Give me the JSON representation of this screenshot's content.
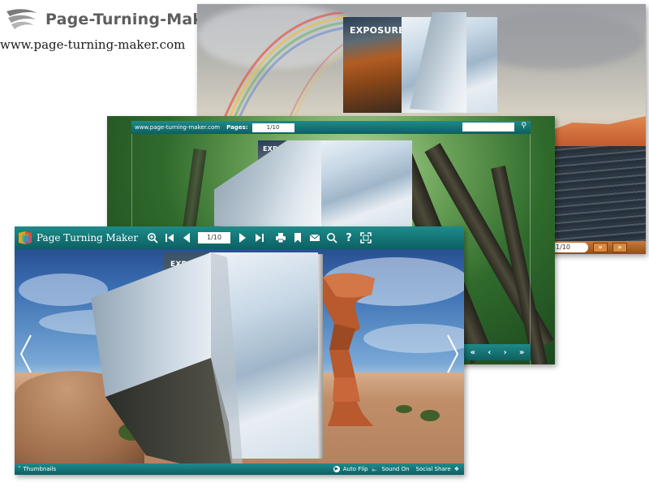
{
  "brand": {
    "name": "Page-Turning-Maker",
    "url": "www.page-turning-maker.com"
  },
  "back_window": {
    "cover_title": "EXPOSURE",
    "page_value": "1/10",
    "next_label": "»",
    "last_label": "»"
  },
  "middle_window": {
    "site_label": "www.page-turning-maker.com",
    "pages_label": "Pages:",
    "page_value": "1/10",
    "search_placeholder": "",
    "cover_title": "EXPO",
    "nav": {
      "first": "«",
      "prev": "‹",
      "next": "›",
      "last": "»"
    }
  },
  "front_window": {
    "app_title": "Page Turning Maker",
    "page_value": "1/10",
    "toolbar_icons": [
      "zoom-in-icon",
      "first-page-icon",
      "prev-page-icon",
      "next-page-icon",
      "last-page-icon",
      "print-icon",
      "bookmark-icon",
      "email-icon",
      "search-icon",
      "help-icon",
      "fullscreen-icon"
    ],
    "help_glyph": "?",
    "thumbnails_label": "Thumbnails",
    "auto_flip_label": "Auto Flip",
    "sound_label": "Sound On",
    "social_share_label": "Social Share",
    "cover_title": "EXPOSURE"
  },
  "colors": {
    "toolbar_teal": "#0c6063",
    "back_toolbar": "#8f4f1c",
    "brand_grey": "#5e5e5e"
  }
}
